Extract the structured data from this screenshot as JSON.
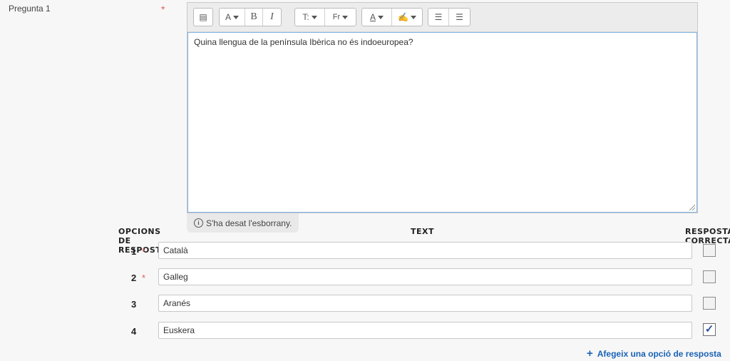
{
  "question": {
    "label": "Pregunta 1",
    "required_mark": "*",
    "text": "Quina llengua de la península Ibèrica no és indoeuropea?"
  },
  "toolbar": {
    "buttons": {
      "collapse": "▤",
      "font_size": "A",
      "bold": "B",
      "italic": "I",
      "style": "T:",
      "font": "Fr",
      "font_color": "A",
      "highlight": "✍",
      "bullet_list": "☰",
      "numbered_list": "☰"
    }
  },
  "draft_status": "S'ha desat l'esborrany.",
  "table": {
    "headers": {
      "options": "OPCIONS DE RESPOSTA",
      "text": "TEXT",
      "correct": "RESPOSTA CORRECTA"
    },
    "rows": [
      {
        "num": "1",
        "required": "*",
        "value": "Català",
        "correct": false
      },
      {
        "num": "2",
        "required": "*",
        "value": "Galleg",
        "correct": false
      },
      {
        "num": "3",
        "required": "",
        "value": "Aranés",
        "correct": false
      },
      {
        "num": "4",
        "required": "",
        "value": "Euskera",
        "correct": true
      }
    ]
  },
  "add_option": {
    "icon": "+",
    "label": "Afegeix una opció de resposta"
  },
  "colors": {
    "required": "#e8595e",
    "link": "#1a63b5",
    "focus_border": "#7fb3e3"
  }
}
